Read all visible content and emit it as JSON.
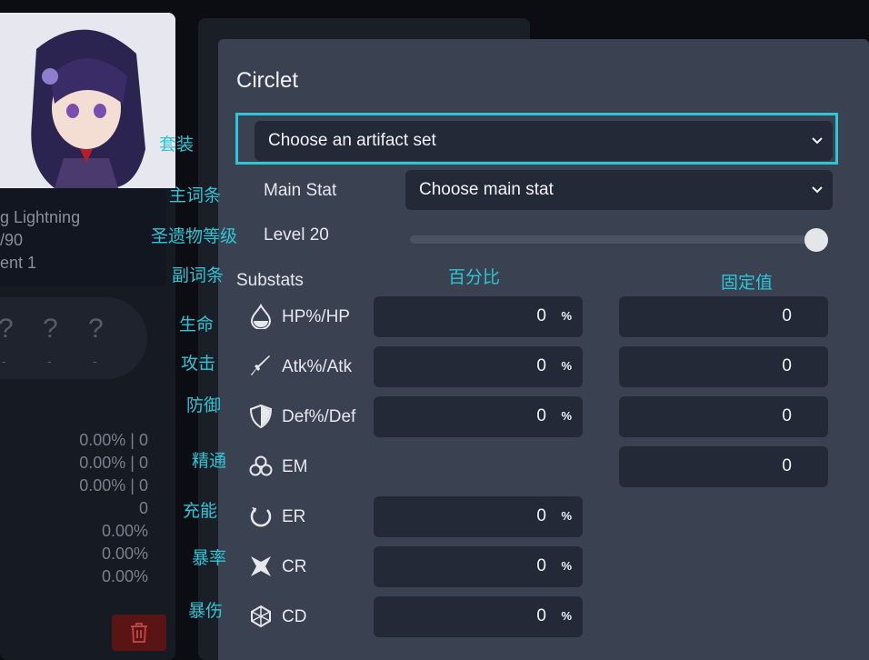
{
  "character": {
    "name_partial": "g Lightning",
    "level_partial": "/90",
    "refine_partial": "ent 1",
    "slots": [
      "?",
      "?",
      "?"
    ],
    "slot_dashes": [
      "-",
      "-",
      "-"
    ],
    "stat_lines": [
      "0.00% | 0",
      "0.00% | 0",
      "0.00% | 0",
      "0",
      "0.00%",
      "0.00%",
      "0.00%"
    ]
  },
  "modal": {
    "title": "Circlet",
    "set_select": "Choose an artifact set",
    "main_stat_label": "Main Stat",
    "main_stat_select": "Choose main stat",
    "level_label": "Level 20",
    "level_value": 20,
    "level_max": 20,
    "substats_label": "Substats",
    "substats": [
      {
        "name": "HP%/HP",
        "icon": "hp-drop-icon",
        "percent": "0",
        "flat": "0",
        "has_percent": true,
        "has_flat": true
      },
      {
        "name": "Atk%/Atk",
        "icon": "sword-icon",
        "percent": "0",
        "flat": "0",
        "has_percent": true,
        "has_flat": true
      },
      {
        "name": "Def%/Def",
        "icon": "shield-icon",
        "percent": "0",
        "flat": "0",
        "has_percent": true,
        "has_flat": true
      },
      {
        "name": "EM",
        "icon": "em-rings-icon",
        "flat": "0",
        "has_percent": false,
        "has_flat": true
      },
      {
        "name": "ER",
        "icon": "energy-recharge-icon",
        "percent": "0",
        "has_percent": true,
        "has_flat": false
      },
      {
        "name": "CR",
        "icon": "crit-rate-icon",
        "percent": "0",
        "has_percent": true,
        "has_flat": false
      },
      {
        "name": "CD",
        "icon": "crit-damage-icon",
        "percent": "0",
        "has_percent": true,
        "has_flat": false
      }
    ],
    "percent_symbol": "%"
  },
  "annotations": {
    "set": "套装",
    "main_stat": "主词条",
    "level": "圣遗物等级",
    "substats": "副词条",
    "percent_col": "百分比",
    "flat_col": "固定值",
    "hp": "生命",
    "atk": "攻击",
    "def": "防御",
    "em": "精通",
    "er": "充能",
    "cr": "暴率",
    "cd": "暴伤"
  },
  "colors": {
    "accent": "#2cc6d6",
    "modal_bg": "#3a4150",
    "field_bg": "#232937",
    "danger": "#5b1414"
  }
}
